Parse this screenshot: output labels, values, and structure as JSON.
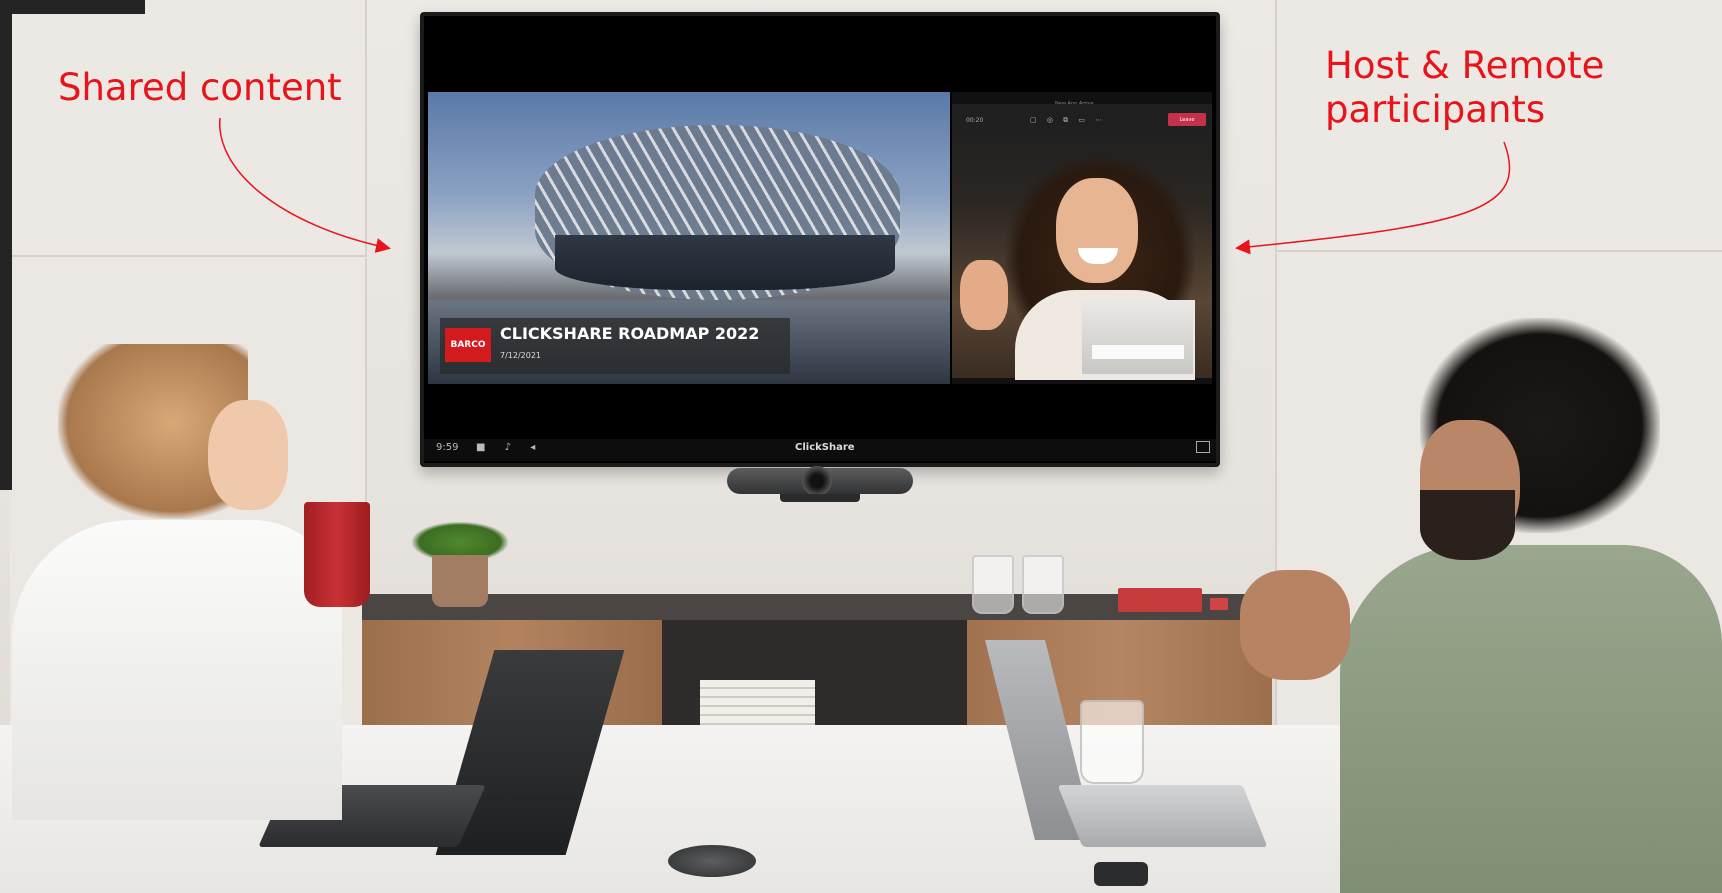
{
  "annotations": {
    "left": "Shared content",
    "right": "Host & Remote\nparticipants",
    "color": "#e8141a"
  },
  "slide": {
    "logo_text": "BARCO",
    "title": "CLICKSHARE ROADMAP 2022",
    "date": "7/12/2021"
  },
  "meeting": {
    "window_title": "New App Arrive",
    "elapsed": "00:20",
    "controls": "▢ ◎ ⧉ ▭ ⋯",
    "leave_label": "Leave"
  },
  "tv_status": {
    "clock": "9:59",
    "icons": "■ ♪ ◂",
    "brand": "ClickShare"
  }
}
